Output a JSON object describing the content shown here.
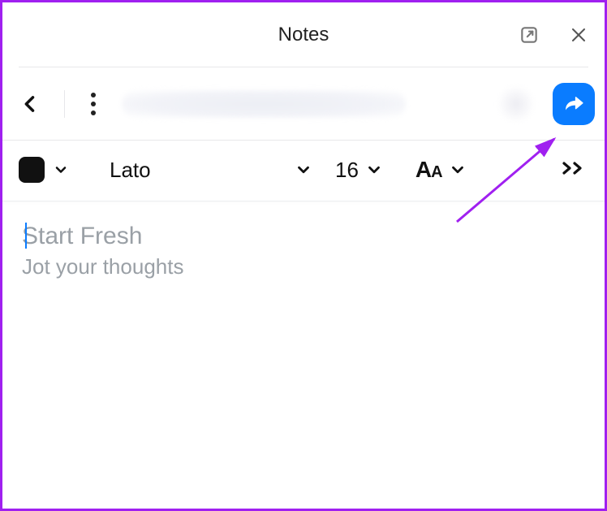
{
  "header": {
    "title": "Notes"
  },
  "format": {
    "color": "#111111",
    "font": "Lato",
    "size": "16"
  },
  "editor": {
    "title_placeholder": "Start Fresh",
    "body_placeholder": "Jot your thoughts"
  },
  "share_bg": "#0a7cff"
}
